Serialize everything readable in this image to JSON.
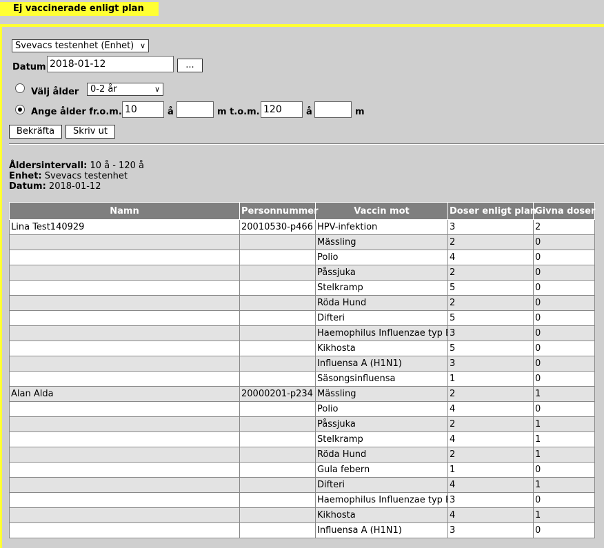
{
  "page_title": "Ej vaccinerade enligt plan",
  "unit_select": "Svevacs testenhet (Enhet)",
  "date_label": "Datum",
  "date_value": "2018-01-12",
  "date_picker_label": "...",
  "choose_age_label": "Välj ålder",
  "age_select": "0-2 år",
  "enter_age_label": "Ange ålder fr.o.m.",
  "age_from_years": "10",
  "age_from_months": "",
  "unit_years": "å",
  "unit_months_tom": "m t.o.m.",
  "age_to_years": "120",
  "age_to_months": "",
  "unit_years_2": "å",
  "unit_months": "m",
  "confirm_button": "Bekräfta",
  "print_button": "Skriv ut",
  "summary": {
    "interval_label": "Åldersintervall:",
    "interval_value": "10 å - 120 å",
    "unit_label": "Enhet:",
    "unit_value": "Svevacs testenhet",
    "date_label": "Datum:",
    "date_value": "2018-01-12"
  },
  "table": {
    "headers": [
      "Namn",
      "Personnummer",
      "Vaccin mot",
      "Doser enligt plan",
      "Givna doser"
    ],
    "rows": [
      [
        "Lina Test140929",
        "20010530-p466",
        "HPV-infektion",
        "3",
        "2"
      ],
      [
        "",
        "",
        "Mässling",
        "2",
        "0"
      ],
      [
        "",
        "",
        "Polio",
        "4",
        "0"
      ],
      [
        "",
        "",
        "Påssjuka",
        "2",
        "0"
      ],
      [
        "",
        "",
        "Stelkramp",
        "5",
        "0"
      ],
      [
        "",
        "",
        "Röda Hund",
        "2",
        "0"
      ],
      [
        "",
        "",
        "Difteri",
        "5",
        "0"
      ],
      [
        "",
        "",
        "Haemophilus Influenzae typ B",
        "3",
        "0"
      ],
      [
        "",
        "",
        "Kikhosta",
        "5",
        "0"
      ],
      [
        "",
        "",
        "Influensa A (H1N1)",
        "3",
        "0"
      ],
      [
        "",
        "",
        "Säsongsinfluensa",
        "1",
        "0"
      ],
      [
        "Alan Alda",
        "20000201-p234",
        "Mässling",
        "2",
        "1"
      ],
      [
        "",
        "",
        "Polio",
        "4",
        "0"
      ],
      [
        "",
        "",
        "Påssjuka",
        "2",
        "1"
      ],
      [
        "",
        "",
        "Stelkramp",
        "4",
        "1"
      ],
      [
        "",
        "",
        "Röda Hund",
        "2",
        "1"
      ],
      [
        "",
        "",
        "Gula febern",
        "1",
        "0"
      ],
      [
        "",
        "",
        "Difteri",
        "4",
        "1"
      ],
      [
        "",
        "",
        "Haemophilus Influenzae typ B",
        "3",
        "0"
      ],
      [
        "",
        "",
        "Kikhosta",
        "4",
        "1"
      ],
      [
        "",
        "",
        "Influensa A (H1N1)",
        "3",
        "0"
      ]
    ]
  }
}
